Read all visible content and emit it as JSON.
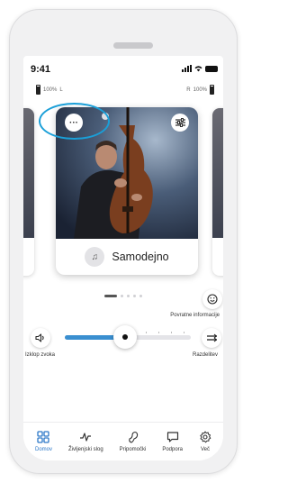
{
  "status_bar": {
    "time": "9:41"
  },
  "hearing_aids": {
    "left": {
      "percent": "100%",
      "side": "L"
    },
    "right": {
      "side": "R",
      "percent": "100%"
    }
  },
  "program_card": {
    "name": "Samodejno",
    "more_label": "···"
  },
  "pager": {
    "count": 5,
    "active_index": 0
  },
  "feedback": {
    "label": "Povratne informacije"
  },
  "volume": {
    "mute_label": "Izklop zvoka",
    "split_label": "Razdelitev",
    "level": 0.48
  },
  "tabs": [
    {
      "label": "Domov",
      "icon": "home-grid-icon",
      "active": true
    },
    {
      "label": "Življenjski slog",
      "icon": "activity-icon",
      "active": false
    },
    {
      "label": "Pripomočki",
      "icon": "hearing-aid-icon",
      "active": false
    },
    {
      "label": "Podpora",
      "icon": "chat-icon",
      "active": false
    },
    {
      "label": "Več",
      "icon": "gear-icon",
      "active": false
    }
  ],
  "colors": {
    "accent": "#2c78c8",
    "slider_fill": "#3a8fd0",
    "highlight": "#1a9fd8"
  }
}
